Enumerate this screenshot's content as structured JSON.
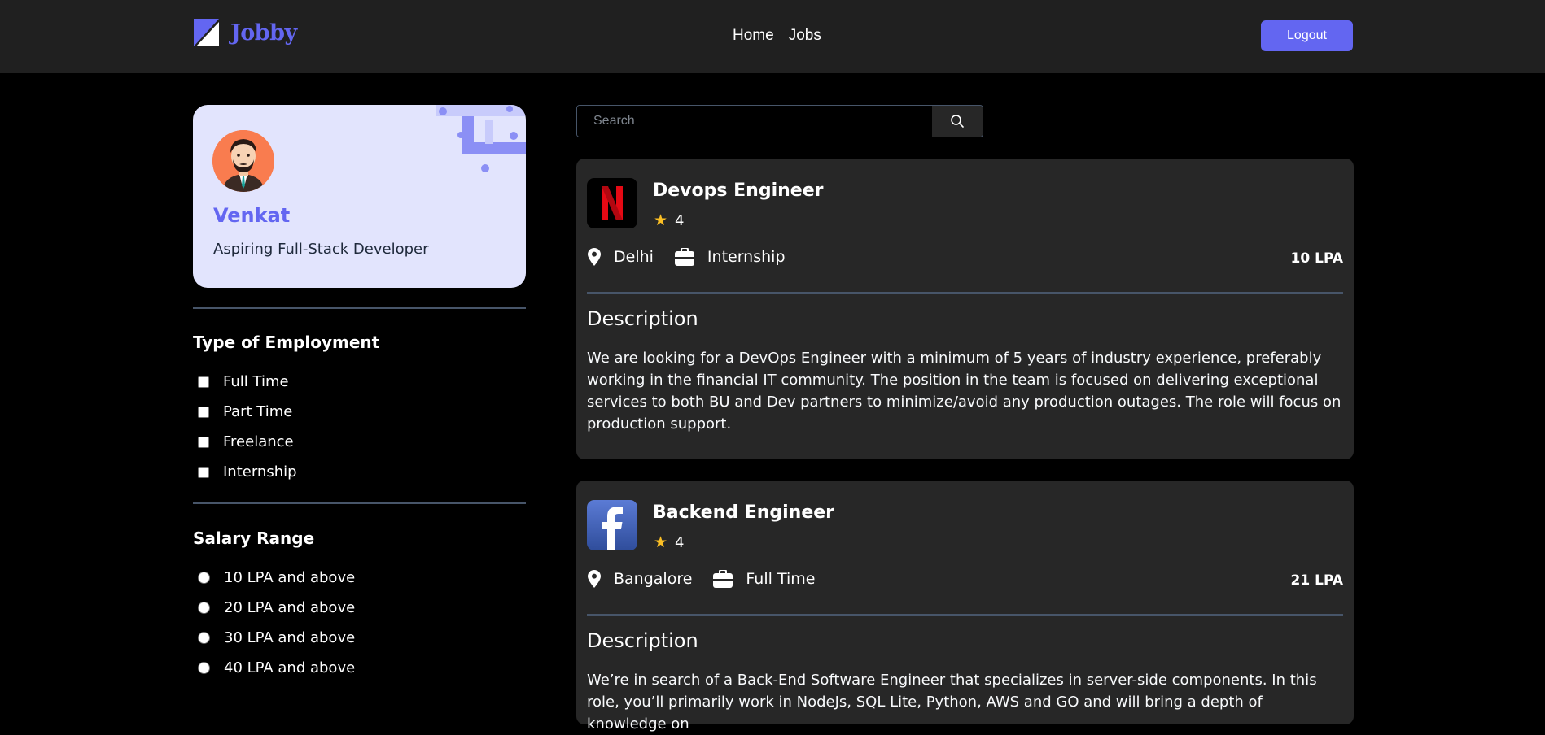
{
  "navbar": {
    "brand": "Jobby",
    "links": [
      "Home",
      "Jobs"
    ],
    "logout_label": "Logout",
    "accent_color": "#6366f1"
  },
  "profile": {
    "name": "Venkat",
    "bio": "Aspiring Full-Stack Developer",
    "avatar_icon": "man-avatar-icon"
  },
  "filters": {
    "employment_title": "Type of Employment",
    "employment_types": [
      "Full Time",
      "Part Time",
      "Freelance",
      "Internship"
    ],
    "salary_title": "Salary Range",
    "salary_ranges": [
      "10 LPA and above",
      "20 LPA and above",
      "30 LPA and above",
      "40 LPA and above"
    ]
  },
  "search": {
    "placeholder": "Search",
    "value": ""
  },
  "jobs": [
    {
      "title": "Devops Engineer",
      "rating": "4",
      "location": "Delhi",
      "employment_type": "Internship",
      "package": "10 LPA",
      "company_logo_icon": "netflix-logo-icon",
      "description_heading": "Description",
      "description": "We are looking for a DevOps Engineer with a minimum of 5 years of industry experience, preferably working in the financial IT community. The position in the team is focused on delivering exceptional services to both BU and Dev partners to minimize/avoid any production outages. The role will focus on production support."
    },
    {
      "title": "Backend Engineer",
      "rating": "4",
      "location": "Bangalore",
      "employment_type": "Full Time",
      "package": "21 LPA",
      "company_logo_icon": "facebook-logo-icon",
      "description_heading": "Description",
      "description": "We’re in search of a Back-End Software Engineer that specializes in server-side components. In this role, you’ll primarily work in NodeJs, SQL Lite, Python, AWS and GO and will bring a depth of knowledge on"
    }
  ]
}
